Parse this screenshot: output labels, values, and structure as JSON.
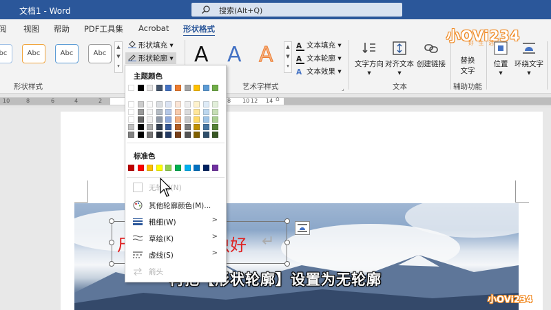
{
  "window": {
    "title": "文档1  -  Word"
  },
  "search": {
    "placeholder": "搜索(Alt+Q)"
  },
  "tabs": [
    {
      "label": "阅"
    },
    {
      "label": "视图"
    },
    {
      "label": "帮助"
    },
    {
      "label": "PDF工具集"
    },
    {
      "label": "Acrobat"
    },
    {
      "label": "形状格式",
      "active": true
    }
  ],
  "ribbon": {
    "shape_styles": {
      "preset_label": "Abc",
      "group_label": "形状样式"
    },
    "shape_fill_label": "形状填充",
    "shape_outline_label": "形状轮廓",
    "wordart": {
      "glyph": "A",
      "group_label": "艺术字样式"
    },
    "text_fill_label": "文本填充",
    "text_outline_label": "文本轮廓",
    "text_effects_label": "文本效果",
    "text_group": {
      "direction_label": "文字方向",
      "align_label": "对齐文本",
      "link_label": "创建链接",
      "group_label": "文本"
    },
    "accessibility": {
      "alt_text_line1": "替换",
      "alt_text_line2": "文字",
      "group_label": "辅助功能"
    },
    "arrange": {
      "position_label": "位置",
      "wrap_label": "环绕文字"
    }
  },
  "ruler": {
    "numbers": [
      "10",
      "8",
      "6",
      "4",
      "2",
      "2",
      "4",
      "6",
      "8",
      "10",
      "12",
      "14"
    ]
  },
  "outline_menu": {
    "theme_colors_title": "主题颜色",
    "standard_colors_title": "标准色",
    "no_outline_label": "无轮廓(N)",
    "more_colors_label": "其他轮廓颜色(M)...",
    "weight_label": "粗细(W)",
    "sketch_label": "草绘(K)",
    "dashes_label": "虚线(S)",
    "arrows_label": "箭头",
    "theme_top_row": [
      "#ffffff",
      "#000000",
      "#e7e6e6",
      "#44546a",
      "#4472c4",
      "#ed7d31",
      "#a5a5a5",
      "#ffc000",
      "#5b9bd5",
      "#70ad47"
    ],
    "standard_colors": [
      "#c00000",
      "#ff0000",
      "#ffc000",
      "#ffff00",
      "#92d050",
      "#00b050",
      "#00b0f0",
      "#0070c0",
      "#002060",
      "#7030a0"
    ]
  },
  "document": {
    "text_left": "尺",
    "text_right": "虫好",
    "paragraph_mark": "↵"
  },
  "subtitle": "再把【形状轮廓】设置为无轮廓",
  "watermark": {
    "logo": "小OVi234",
    "logo_sub": "好 生 活",
    "logo_small": "小OVi234"
  }
}
